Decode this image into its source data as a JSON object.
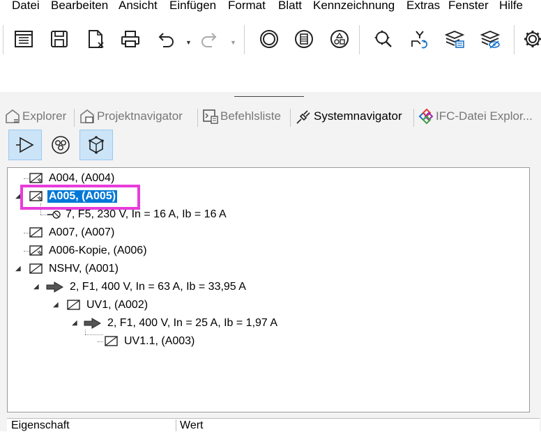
{
  "menu": {
    "items": [
      "Datei",
      "Bearbeiten",
      "Ansicht",
      "Einfügen",
      "Format",
      "Blatt",
      "Kennzeichnung",
      "Extras",
      "Fenster",
      "Hilfe"
    ]
  },
  "toolbar": {
    "icons": [
      "document-list-icon",
      "save-icon",
      "close-document-icon",
      "print-icon",
      "undo-icon",
      "redo-icon",
      "circle-icon",
      "cabinet-icon",
      "symbols-icon",
      "zoom-fit-icon",
      "route-icon",
      "layers-icon",
      "layers-eye-icon",
      "settings-icon"
    ]
  },
  "tabs": [
    {
      "label": "Explorer",
      "icon": "house-icon"
    },
    {
      "label": "Projektnavigator",
      "icon": "house-navigator-icon"
    },
    {
      "label": "Befehlsliste",
      "icon": "command-list-icon"
    },
    {
      "label": "Systemnavigator",
      "icon": "plug-icon"
    },
    {
      "label": "IFC-Datei Explor...",
      "icon": "ifc-icon"
    }
  ],
  "subtoolbar": {
    "icons": [
      "play-arrow-icon",
      "three-circles-icon",
      "cube-icon"
    ]
  },
  "tree": {
    "rows": [
      {
        "label": "A004,  (A004)"
      },
      {
        "label": "A005,  (A005)"
      },
      {
        "label": "7, F5, 230 V, In = 16 A, Ib = 16 A"
      },
      {
        "label": "A007,  (A007)"
      },
      {
        "label": "A006-Kopie,  (A006)"
      },
      {
        "label": "NSHV,  (A001)"
      },
      {
        "label": "2, F1, 400 V, In = 63 A, Ib = 33,95 A"
      },
      {
        "label": "UV1,  (A002)"
      },
      {
        "label": "2, F1, 400 V, In = 25 A, Ib = 1,97 A"
      },
      {
        "label": "UV1.1,  (A003)"
      }
    ]
  },
  "properties": {
    "col1": "Eigenschaft",
    "col2": "Wert"
  }
}
